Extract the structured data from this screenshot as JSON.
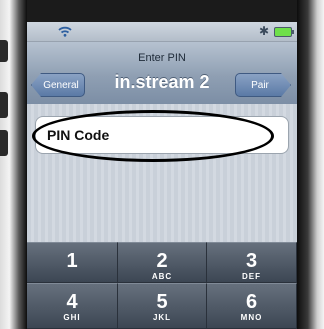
{
  "status_bar": {
    "wifi_icon": "wifi-icon",
    "bluetooth_icon": "bluetooth-icon",
    "battery_icon": "battery-icon"
  },
  "nav": {
    "prompt": "Enter PIN",
    "title": "in.stream 2",
    "back_label": "General",
    "forward_label": "Pair"
  },
  "pin_field": {
    "placeholder": "PIN Code"
  },
  "keypad": {
    "keys": [
      {
        "number": "1",
        "letters": ""
      },
      {
        "number": "2",
        "letters": "ABC"
      },
      {
        "number": "3",
        "letters": "DEF"
      },
      {
        "number": "4",
        "letters": "GHI"
      },
      {
        "number": "5",
        "letters": "JKL"
      },
      {
        "number": "6",
        "letters": "MNO"
      }
    ]
  },
  "colors": {
    "nav_bar": "#8f9fb3",
    "nav_button": "#5b7aa6",
    "keypad": "#3b4553",
    "battery": "#6fe04a"
  }
}
